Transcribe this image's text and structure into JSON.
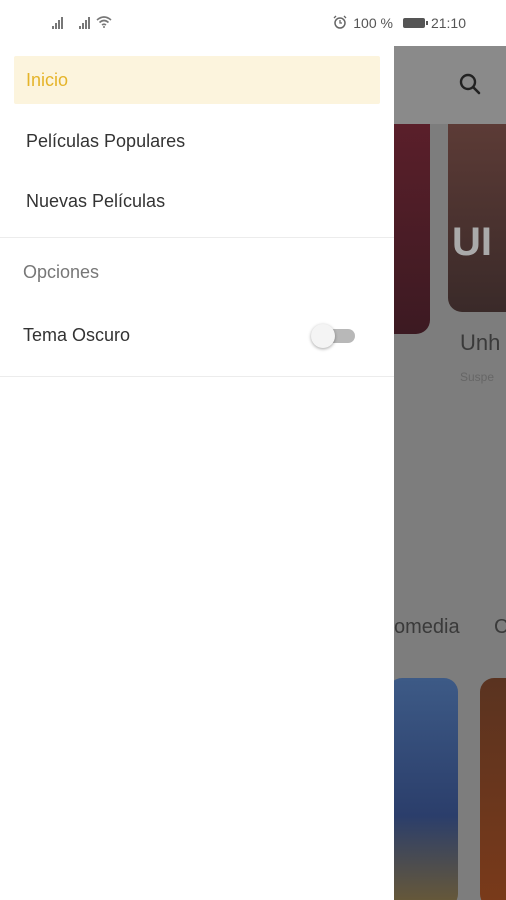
{
  "status_bar": {
    "battery": "100 %",
    "time": "21:10"
  },
  "drawer": {
    "items": [
      {
        "label": "Inicio"
      },
      {
        "label": "Películas Populares"
      },
      {
        "label": "Nuevas Películas"
      }
    ],
    "section_title": "Opciones",
    "dark_theme": {
      "label": "Tema Oscuro",
      "enabled": false
    }
  },
  "background": {
    "movie_title": "Unh",
    "movie_genre": "Suspe",
    "genre_tab_1": "omedia",
    "genre_tab_2": "C"
  },
  "colors": {
    "accent": "#e5b42a",
    "active_bg": "#fcf4dd",
    "scrim": "#7d7d7d"
  }
}
